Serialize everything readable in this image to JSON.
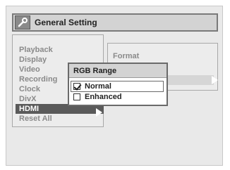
{
  "title_bar": {
    "title": "General Setting",
    "icon": "wrench-icon"
  },
  "menu": {
    "items": [
      {
        "label": "Playback",
        "selected": false
      },
      {
        "label": "Display",
        "selected": false
      },
      {
        "label": "Video",
        "selected": false
      },
      {
        "label": "Recording",
        "selected": false
      },
      {
        "label": "Clock",
        "selected": false
      },
      {
        "label": "DivX",
        "selected": false
      },
      {
        "label": "HDMI",
        "selected": true
      },
      {
        "label": "Reset All",
        "selected": false
      }
    ]
  },
  "submenu": {
    "label": "Format"
  },
  "popup": {
    "title": "RGB Range",
    "options": [
      {
        "label": "Normal",
        "checked": true
      },
      {
        "label": "Enhanced",
        "checked": false
      }
    ]
  },
  "colors": {
    "selected_bg": "#5a5a5a",
    "panel_bg": "#ececec",
    "disabled_text": "#8a8a8a"
  }
}
